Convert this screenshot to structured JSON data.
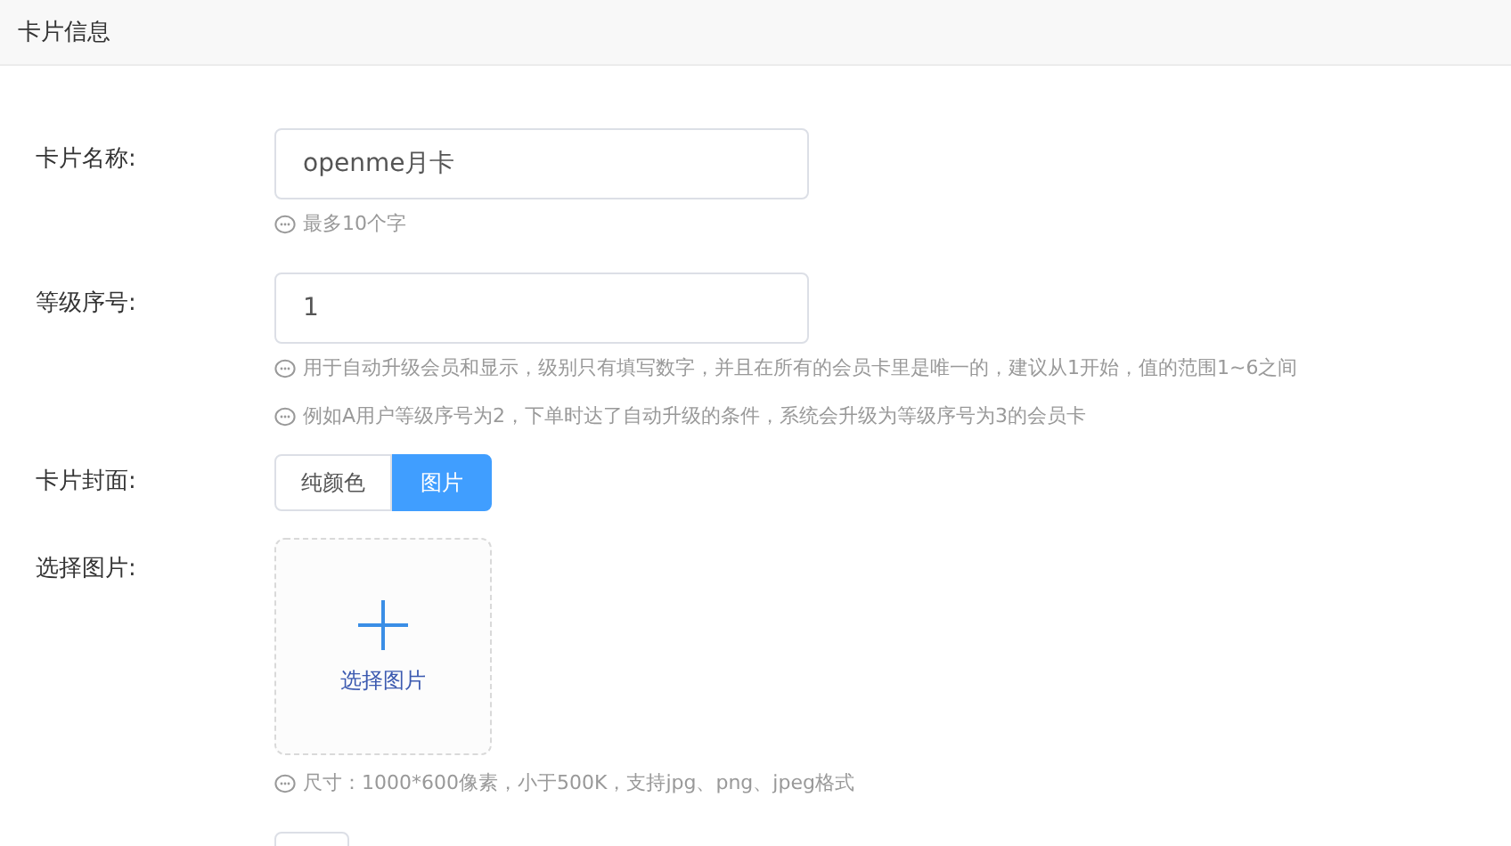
{
  "panel": {
    "title": "卡片信息"
  },
  "fields": [
    {
      "kind": "input",
      "label": "卡片名称:",
      "value": "openme月卡",
      "hints": [
        "最多10个字"
      ]
    },
    {
      "kind": "input",
      "label": "等级序号:",
      "value": "1",
      "hints": [
        "用于自动升级会员和显示，级别只有填写数字，并且在所有的会员卡里是唯一的，建议从1开始，值的范围1~6之间",
        "例如A用户等级序号为2，下单时达了自动升级的条件，系统会升级为等级序号为3的会员卡"
      ]
    },
    {
      "kind": "segmented",
      "label": "卡片封面:",
      "options": [
        {
          "label": "纯颜色",
          "selected": false
        },
        {
          "label": "图片",
          "selected": true
        }
      ]
    },
    {
      "kind": "upload",
      "label": "选择图片:",
      "button": "选择图片",
      "hints": [
        "尺寸：1000*600像素，小于500K，支持jpg、png、jpeg格式"
      ]
    },
    {
      "kind": "partial"
    }
  ]
}
